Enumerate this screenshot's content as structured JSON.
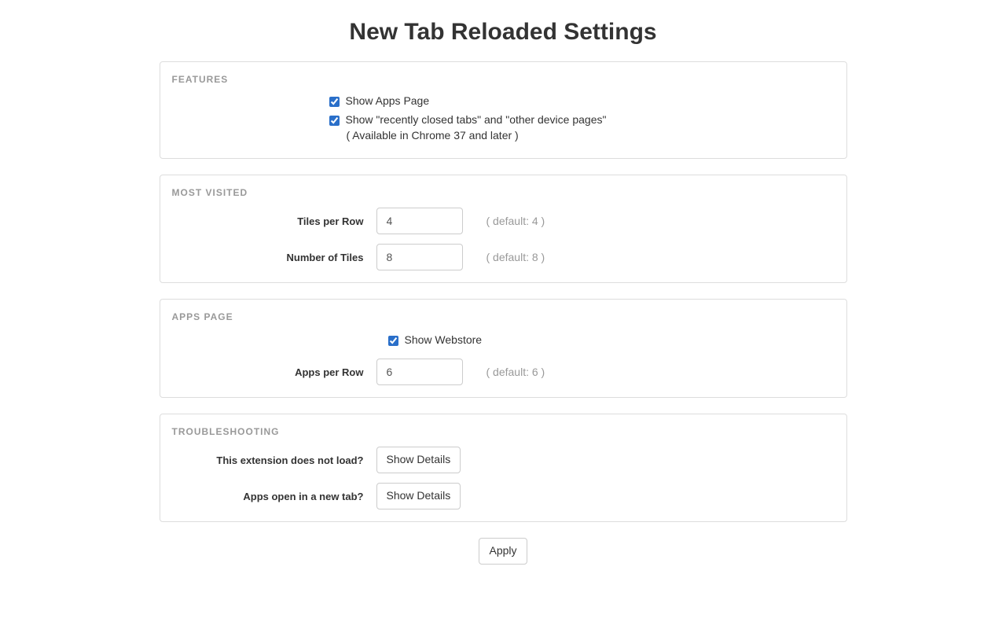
{
  "page_title": "New Tab Reloaded Settings",
  "features": {
    "heading": "FEATURES",
    "show_apps_page": {
      "label": "Show Apps Page",
      "checked": true
    },
    "show_recent": {
      "label": "Show \"recently closed tabs\" and \"other device pages\"",
      "sublabel": "( Available in Chrome 37 and later )",
      "checked": true
    }
  },
  "most_visited": {
    "heading": "MOST VISITED",
    "tiles_per_row": {
      "label": "Tiles per Row",
      "value": "4",
      "hint": "( default: 4 )"
    },
    "num_tiles": {
      "label": "Number of Tiles",
      "value": "8",
      "hint": "( default: 8 )"
    }
  },
  "apps_page": {
    "heading": "APPS PAGE",
    "show_webstore": {
      "label": "Show Webstore",
      "checked": true
    },
    "apps_per_row": {
      "label": "Apps per Row",
      "value": "6",
      "hint": "( default: 6 )"
    }
  },
  "troubleshooting": {
    "heading": "TROUBLESHOOTING",
    "not_load": {
      "label": "This extension does not load?",
      "button": "Show Details"
    },
    "new_tab": {
      "label": "Apps open in a new tab?",
      "button": "Show Details"
    }
  },
  "apply_label": "Apply"
}
